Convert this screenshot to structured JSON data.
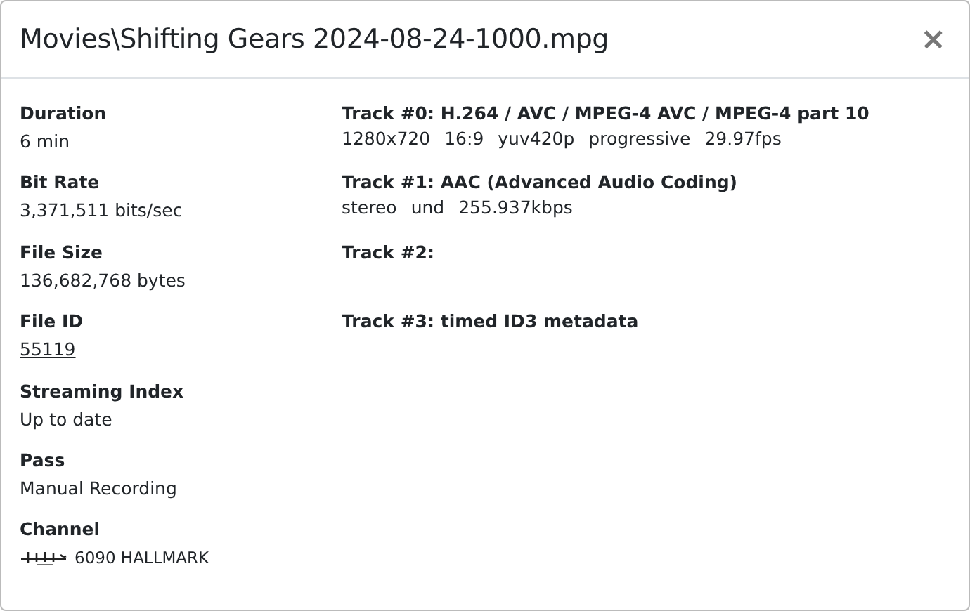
{
  "dialog": {
    "title": "Movies\\Shifting Gears 2024-08-24-1000.mpg",
    "close": "×"
  },
  "fields": [
    {
      "kind": "text",
      "label": "Duration",
      "value": "6 min"
    },
    {
      "kind": "text",
      "label": "Bit Rate",
      "value": "3,371,511 bits/sec"
    },
    {
      "kind": "text",
      "label": "File Size",
      "value": "136,682,768 bytes"
    },
    {
      "kind": "link",
      "label": "File ID",
      "value": "55119"
    },
    {
      "kind": "text",
      "label": "Streaming Index",
      "value": "Up to date"
    },
    {
      "kind": "text",
      "label": "Pass",
      "value": "Manual Recording"
    },
    {
      "kind": "channel",
      "label": "Channel",
      "value": "6090 HALLMARK"
    }
  ],
  "tracks": [
    {
      "title": "Track #0: H.264 / AVC / MPEG-4 AVC / MPEG-4 part 10",
      "details": [
        "1280x720",
        "16:9",
        "yuv420p",
        "progressive",
        "29.97fps"
      ]
    },
    {
      "title": "Track #1: AAC (Advanced Audio Coding)",
      "details": [
        "stereo",
        "und",
        "255.937kbps"
      ]
    },
    {
      "title": "Track #2:"
    },
    {
      "title": "Track #3: timed ID3 metadata"
    }
  ]
}
